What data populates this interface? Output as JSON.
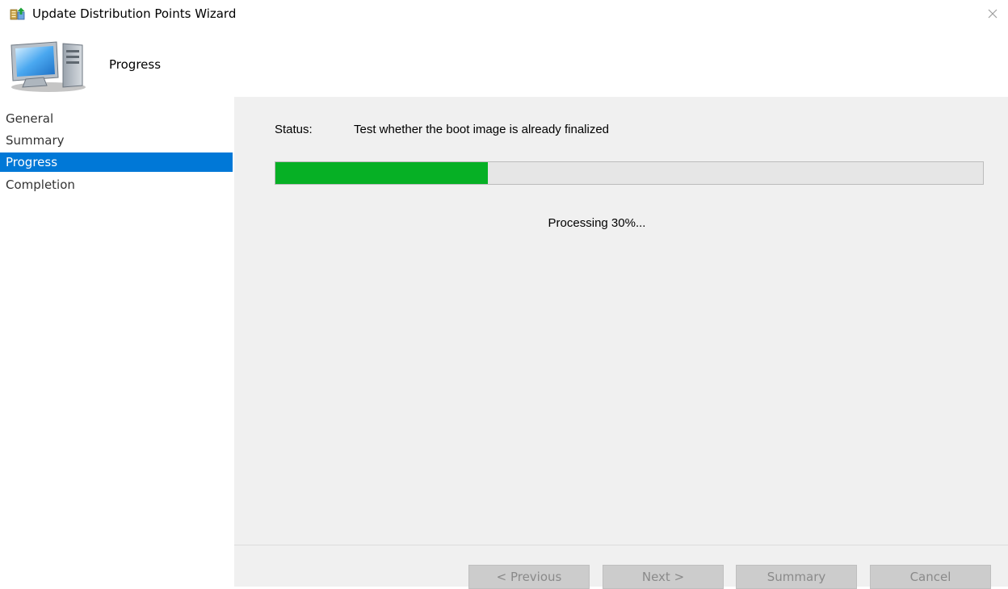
{
  "window": {
    "title": "Update Distribution Points Wizard",
    "close_icon": "close-icon",
    "app_icon": "wizard-app-icon"
  },
  "header": {
    "heading": "Progress",
    "icon": "computer-icon"
  },
  "sidebar": {
    "items": [
      {
        "label": "General",
        "active": false
      },
      {
        "label": "Summary",
        "active": false
      },
      {
        "label": "Progress",
        "active": true
      },
      {
        "label": "Completion",
        "active": false
      }
    ]
  },
  "main": {
    "status_label": "Status:",
    "status_text": "Test whether the boot image is already finalized",
    "progress_percent": 30,
    "processing_text": "Processing 30%..."
  },
  "footer": {
    "previous_label": "< Previous",
    "next_label": "Next >",
    "summary_label": "Summary",
    "cancel_label": "Cancel"
  },
  "colors": {
    "accent": "#0078d7",
    "progress_fill": "#06b025",
    "content_bg": "#f0f0f0"
  }
}
